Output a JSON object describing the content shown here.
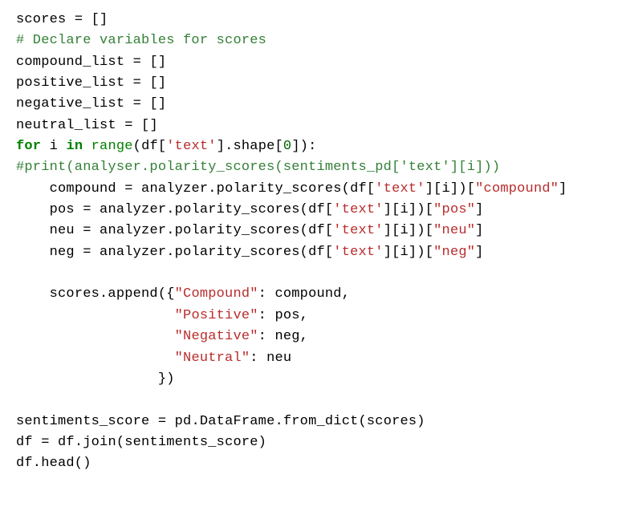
{
  "code": {
    "l01": {
      "v1": "scores",
      "eq": " = ",
      "b": "[]"
    },
    "l02": {
      "c": "# Declare variables for scores"
    },
    "l03": {
      "v1": "compound_list",
      "eq": " = ",
      "b": "[]"
    },
    "l04": {
      "v1": "positive_list",
      "eq": " = ",
      "b": "[]"
    },
    "l05": {
      "v1": "negative_list",
      "eq": " = ",
      "b": "[]"
    },
    "l06": {
      "v1": "neutral_list",
      "eq": " = ",
      "b": "[]"
    },
    "l07": {
      "kfor": "for",
      "sp1": " ",
      "v1": "i",
      "sp2": " ",
      "kin": "in",
      "sp3": " ",
      "fn": "range",
      "p1": "(df[",
      "s1": "'text'",
      "p2": "].shape[",
      "n": "0",
      "p3": "]):"
    },
    "l08": {
      "c": "#print(analyser.polarity_scores(sentiments_pd['text'][i]))"
    },
    "l09": {
      "ind": "    ",
      "v1": "compound",
      "eq": " = ",
      "v2": "analyzer.polarity_scores(df[",
      "s1": "'text'",
      "p1": "][i])[",
      "s2": "\"compound\"",
      "p2": "]"
    },
    "l10": {
      "ind": "    ",
      "v1": "pos",
      "eq": " = ",
      "v2": "analyzer.polarity_scores(df[",
      "s1": "'text'",
      "p1": "][i])[",
      "s2": "\"pos\"",
      "p2": "]"
    },
    "l11": {
      "ind": "    ",
      "v1": "neu",
      "eq": " = ",
      "v2": "analyzer.polarity_scores(df[",
      "s1": "'text'",
      "p1": "][i])[",
      "s2": "\"neu\"",
      "p2": "]"
    },
    "l12": {
      "ind": "    ",
      "v1": "neg",
      "eq": " = ",
      "v2": "analyzer.polarity_scores(df[",
      "s1": "'text'",
      "p1": "][i])[",
      "s2": "\"neg\"",
      "p2": "]"
    },
    "l13": {
      "t": " "
    },
    "l14": {
      "ind": "    ",
      "v1": "scores.append({",
      "s1": "\"Compound\"",
      "p1": ": compound,"
    },
    "l15": {
      "ind": "                   ",
      "s1": "\"Positive\"",
      "p1": ": pos,"
    },
    "l16": {
      "ind": "                   ",
      "s1": "\"Negative\"",
      "p1": ": neg,"
    },
    "l17": {
      "ind": "                   ",
      "s1": "\"Neutral\"",
      "p1": ": neu"
    },
    "l18": {
      "ind": "                 ",
      "p1": "})"
    },
    "l19": {
      "t": " "
    },
    "l20": {
      "v1": "sentiments_score",
      "eq": " = ",
      "v2": "pd.DataFrame.from_dict(scores)"
    },
    "l21": {
      "v1": "df",
      "eq": " = ",
      "v2": "df.join(sentiments_score)"
    },
    "l22": {
      "v1": "df.head()"
    }
  }
}
